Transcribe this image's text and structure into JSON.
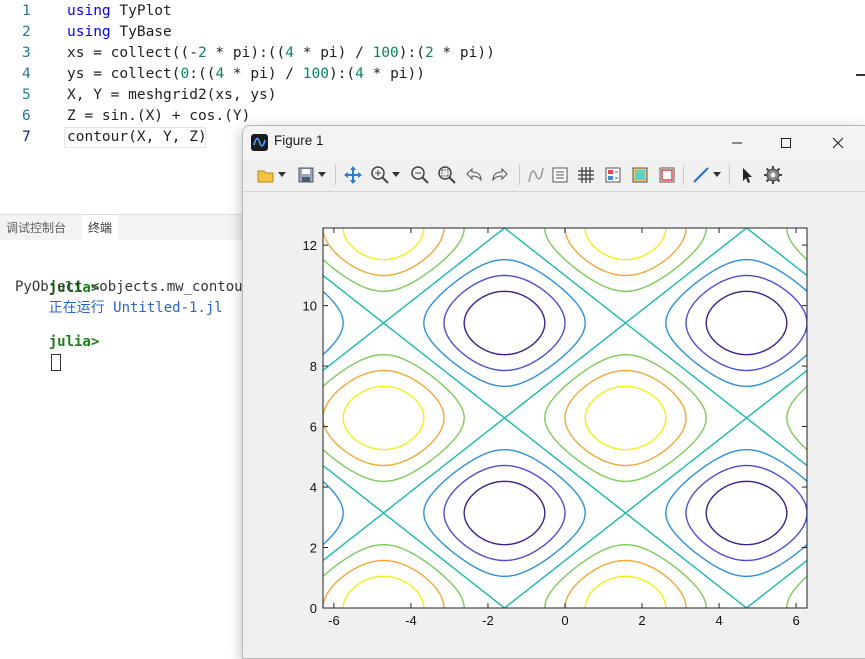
{
  "editor": {
    "lines": [
      {
        "num": "1",
        "parts": [
          [
            "kw",
            "using"
          ],
          [
            "t",
            " TyPlot"
          ]
        ]
      },
      {
        "num": "2",
        "parts": [
          [
            "kw",
            "using"
          ],
          [
            "t",
            " TyBase"
          ]
        ]
      },
      {
        "num": "3",
        "parts": [
          [
            "t",
            "xs = collect(("
          ],
          [
            "t",
            "-"
          ],
          [
            "num",
            "2"
          ],
          [
            "t",
            " * pi):(("
          ],
          [
            "num",
            "4"
          ],
          [
            "t",
            " * pi) / "
          ],
          [
            "num",
            "100"
          ],
          [
            "t",
            "):("
          ],
          [
            "num",
            "2"
          ],
          [
            "t",
            " * pi))"
          ]
        ]
      },
      {
        "num": "4",
        "parts": [
          [
            "t",
            "ys = collect("
          ],
          [
            "num",
            "0"
          ],
          [
            "t",
            ":(("
          ],
          [
            "num",
            "4"
          ],
          [
            "t",
            " * pi) / "
          ],
          [
            "num",
            "100"
          ],
          [
            "t",
            "):("
          ],
          [
            "num",
            "4"
          ],
          [
            "t",
            " * pi))"
          ]
        ]
      },
      {
        "num": "5",
        "parts": [
          [
            "t",
            "X, Y = meshgrid2(xs, ys)"
          ]
        ]
      },
      {
        "num": "6",
        "parts": [
          [
            "t",
            "Z = sin.(X) + cos.(Y)"
          ]
        ]
      },
      {
        "num": "7",
        "parts": [
          [
            "t",
            "contour(X, Y, Z)"
          ]
        ]
      }
    ]
  },
  "panel": {
    "tabs": [
      "调试控制台",
      "终端"
    ],
    "active_tab": "终端"
  },
  "terminal": {
    "line1_prompt": "julia>",
    "line1_text": "正在运行 Untitled-1.jl",
    "line2_text": "PyObject <objects.mw_contour.",
    "line3_prompt": "julia>"
  },
  "figure": {
    "title": "Figure 1",
    "toolbar_icons": [
      "open-folder-icon",
      "save-icon",
      "pan-icon",
      "zoom-in-icon",
      "zoom-out-icon",
      "zoom-fit-icon",
      "undo-icon",
      "redo-icon",
      "data-cursor-icon",
      "legend-icon",
      "grid-icon",
      "colorbar-icon",
      "fill-icon",
      "box-icon",
      "line-style-icon",
      "select-arrow-icon",
      "settings-gear-icon"
    ]
  },
  "chart_data": {
    "type": "contour",
    "function": "Z = sin(X) + cos(Y)",
    "x_range": [
      -6.283,
      6.283
    ],
    "y_range": [
      0,
      12.566
    ],
    "xticks": [
      "-6",
      "-4",
      "-2",
      "0",
      "2",
      "4",
      "6"
    ],
    "yticks": [
      "0",
      "2",
      "4",
      "6",
      "8",
      "10",
      "12"
    ],
    "levels": [
      -1.5,
      -1.0,
      -0.5,
      0.0,
      0.5,
      1.0,
      1.5
    ],
    "level_colors": [
      "#3b1f8e",
      "#4a4fd0",
      "#2e8fd8",
      "#1ab8b0",
      "#7ccb5a",
      "#f0a83a",
      "#f2ef1a"
    ],
    "title": "",
    "xlabel": "",
    "ylabel": ""
  }
}
